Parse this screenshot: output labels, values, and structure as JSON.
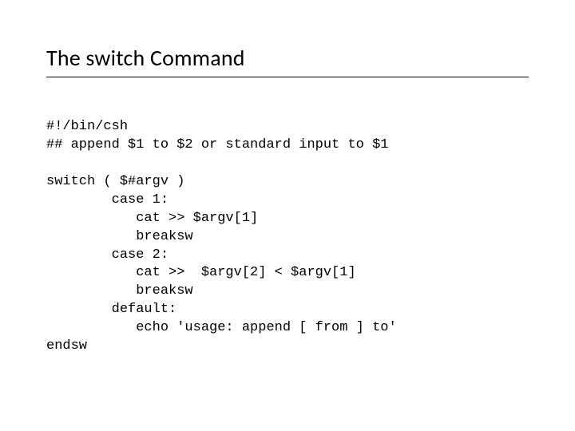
{
  "title": "The switch Command",
  "code": {
    "l1": "#!/bin/csh",
    "l2": "## append $1 to $2 or standard input to $1",
    "l3": "",
    "l4": "switch ( $#argv )",
    "l5": "        case 1:",
    "l6": "           cat >> $argv[1]",
    "l7": "           breaksw",
    "l8": "        case 2:",
    "l9": "           cat >>  $argv[2] < $argv[1]",
    "l10": "           breaksw",
    "l11": "        default:",
    "l12": "           echo 'usage: append [ from ] to'",
    "l13": "endsw"
  }
}
